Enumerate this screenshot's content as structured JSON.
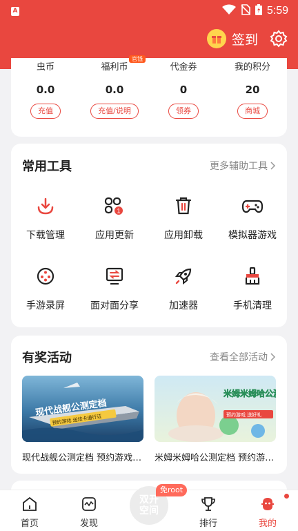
{
  "status_bar": {
    "time": "5:59"
  },
  "header": {
    "signin_label": "签到"
  },
  "wallet": [
    {
      "label": "虫币",
      "value": "0.0",
      "button": "充值"
    },
    {
      "label": "福利币",
      "value": "0.0",
      "button": "充值/说明",
      "badge": "官钱"
    },
    {
      "label": "代金券",
      "value": "0",
      "button": "领券"
    },
    {
      "label": "我的积分",
      "value": "20",
      "button": "商城"
    }
  ],
  "tools": {
    "title": "常用工具",
    "more": "更多辅助工具",
    "items": [
      {
        "label": "下载管理",
        "icon": "download-icon"
      },
      {
        "label": "应用更新",
        "icon": "app-update-icon"
      },
      {
        "label": "应用卸载",
        "icon": "trash-icon"
      },
      {
        "label": "模拟器游戏",
        "icon": "gamepad-icon"
      },
      {
        "label": "手游录屏",
        "icon": "film-reel-icon"
      },
      {
        "label": "面对面分享",
        "icon": "share-screen-icon"
      },
      {
        "label": "加速器",
        "icon": "rocket-icon"
      },
      {
        "label": "手机清理",
        "icon": "broom-icon"
      }
    ]
  },
  "activities": {
    "title": "有奖活动",
    "more": "查看全部活动",
    "items": [
      {
        "caption": "现代战舰公测定档 预约游戏送好礼",
        "banner_title": "现代战舰公测定档",
        "banner_sub": "预约游戏 送炫卡通行证"
      },
      {
        "caption": "米姆米姆哈公测定档 预约游戏送好礼",
        "banner_title": "米姆米姆哈公测定档",
        "banner_sub": "预约游戏 送好礼"
      }
    ]
  },
  "bottom_nav": {
    "items": [
      {
        "label": "首页",
        "icon": "home-icon"
      },
      {
        "label": "发现",
        "icon": "discover-icon"
      },
      {
        "label": "排行",
        "icon": "trophy-icon"
      },
      {
        "label": "我的",
        "icon": "profile-icon"
      }
    ],
    "center_label": "双开空间",
    "center_badge": "免root"
  },
  "colors": {
    "brand": "#e9473f",
    "accent_badge": "#ff6a5b"
  }
}
